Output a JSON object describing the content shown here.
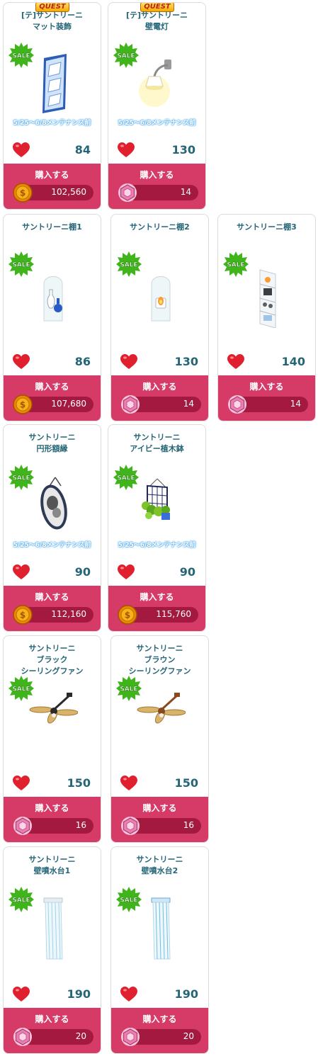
{
  "shop": {
    "buy_label": "購入する",
    "maintenance_note": "5/25～6/8メンテナンス前",
    "quest_badge": "QUEST",
    "sale_badge": "SALE",
    "items": [
      {
        "title1": "[テ]サントリーニ",
        "title2": "マット装飾",
        "title3": "",
        "quest": true,
        "maint": true,
        "likes": "84",
        "currency": "coin",
        "price": "102,560",
        "image": "wall-mat-image"
      },
      {
        "title1": "[テ]サントリーニ",
        "title2": "壁電灯",
        "title3": "",
        "quest": true,
        "maint": true,
        "likes": "130",
        "currency": "gem",
        "price": "14",
        "image": "wall-lamp-image"
      },
      {
        "title1": "サントリーニ棚1",
        "title2": "",
        "title3": "",
        "quest": false,
        "maint": false,
        "likes": "86",
        "currency": "coin",
        "price": "107,680",
        "image": "shelf-1-image"
      },
      {
        "title1": "サントリーニ棚2",
        "title2": "",
        "title3": "",
        "quest": false,
        "maint": false,
        "likes": "130",
        "currency": "gem",
        "price": "14",
        "image": "shelf-2-image"
      },
      {
        "title1": "サントリーニ棚3",
        "title2": "",
        "title3": "",
        "quest": false,
        "maint": false,
        "likes": "140",
        "currency": "gem",
        "price": "14",
        "image": "shelf-3-image"
      },
      {
        "title1": "サントリーニ",
        "title2": "円形額縁",
        "title3": "",
        "quest": false,
        "maint": true,
        "likes": "90",
        "currency": "coin",
        "price": "112,160",
        "image": "round-frame-image"
      },
      {
        "title1": "サントリーニ",
        "title2": "アイビー植木鉢",
        "title3": "",
        "quest": false,
        "maint": true,
        "likes": "90",
        "currency": "coin",
        "price": "115,760",
        "image": "ivy-planter-image"
      },
      {
        "title1": "サントリーニ",
        "title2": "ブラック",
        "title3": "シーリングファン",
        "quest": false,
        "maint": false,
        "likes": "150",
        "currency": "gem",
        "price": "16",
        "image": "black-ceiling-fan-image"
      },
      {
        "title1": "サントリーニ",
        "title2": "ブラウン",
        "title3": "シーリングファン",
        "quest": false,
        "maint": false,
        "likes": "150",
        "currency": "gem",
        "price": "16",
        "image": "brown-ceiling-fan-image"
      },
      {
        "title1": "サントリーニ",
        "title2": "壁噴水台1",
        "title3": "",
        "quest": false,
        "maint": false,
        "likes": "190",
        "currency": "gem",
        "price": "20",
        "image": "wall-fountain-1-image"
      },
      {
        "title1": "サントリーニ",
        "title2": "壁噴水台2",
        "title3": "",
        "quest": false,
        "maint": false,
        "likes": "190",
        "currency": "gem",
        "price": "20",
        "image": "wall-fountain-2-image"
      }
    ]
  },
  "colors": {
    "title_text": "#246577",
    "buy_panel": "#d63a67",
    "price_bar": "#a31940",
    "sale_green": "#3fb51b",
    "maint_glow": "#4aa6e8"
  }
}
